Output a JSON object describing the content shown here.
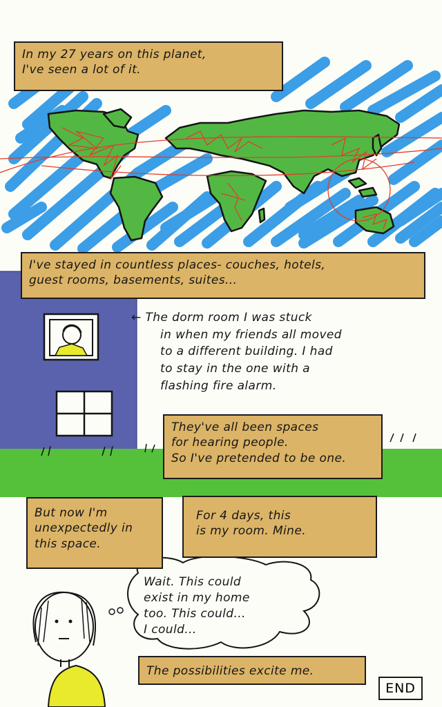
{
  "panel1": {
    "line1": "In my 27 years on this planet,",
    "line2": "I've seen a lot of it."
  },
  "panel2": {
    "line1": "I've stayed in countless places- couches, hotels,",
    "line2": "guest rooms, basements, suites..."
  },
  "dorm": {
    "arrow": "←",
    "lines": [
      "The dorm room I was stuck",
      "in when my friends all moved",
      "to a different building. I had",
      "to stay in the one with a",
      "flashing fire alarm."
    ]
  },
  "panel3": {
    "lines": [
      "They've all been spaces",
      "for hearing people.",
      "So I've pretended to be one."
    ]
  },
  "panel4": {
    "lines": [
      "But now I'm",
      "unexpectedly in",
      "this space."
    ]
  },
  "panel5": {
    "lines": [
      "For 4 days, this",
      "is my room. Mine."
    ]
  },
  "thought": {
    "lines": [
      "Wait. This could",
      "exist in my home",
      "too. This could...",
      "I could..."
    ]
  },
  "panel6": {
    "text": "The possibilities excite me."
  },
  "end": {
    "text": "END"
  },
  "colors": {
    "ocean": "#3b9ee6",
    "land": "#53b843",
    "caption": "#dcb467",
    "building": "#5a62ad",
    "grass": "#55c13a",
    "shirt": "#e8ea2b"
  }
}
